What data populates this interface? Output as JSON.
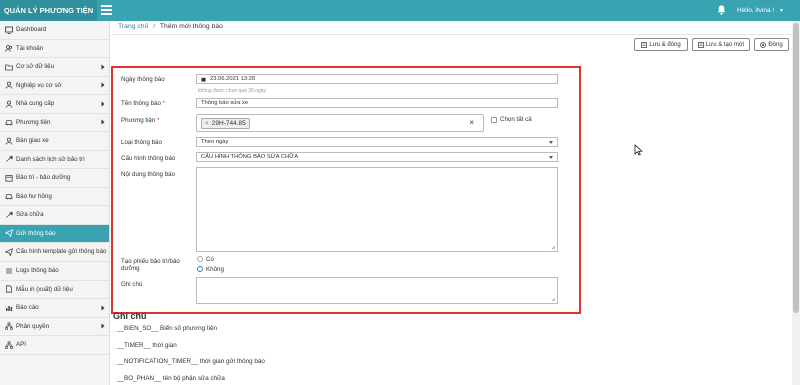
{
  "app": {
    "title": "QUẢN LÝ PHƯƠNG TIỆN",
    "user_greeting": "Hello, itvina !"
  },
  "sidebar": {
    "items": [
      {
        "label": "Dashboard",
        "icon": "monitor-icon",
        "has_arrow": false
      },
      {
        "label": "Tài khoản",
        "icon": "users-icon",
        "has_arrow": false
      },
      {
        "label": "Cơ sở dữ liệu",
        "icon": "folder-icon",
        "has_arrow": true
      },
      {
        "label": "Nghiệp vụ cơ sở",
        "icon": "user-icon",
        "has_arrow": true
      },
      {
        "label": "Nhà cung cấp",
        "icon": "user-icon",
        "has_arrow": true
      },
      {
        "label": "Phương tiện",
        "icon": "car-icon",
        "has_arrow": true
      },
      {
        "label": "Bàn giao xe",
        "icon": "user-icon",
        "has_arrow": false
      },
      {
        "label": "Danh sách lịch sử bảo trì",
        "icon": "wrench-icon",
        "has_arrow": false
      },
      {
        "label": "Bảo trì - bảo dưỡng",
        "icon": "calendar-icon",
        "has_arrow": false
      },
      {
        "label": "Báo hư hỏng",
        "icon": "car-icon",
        "has_arrow": false
      },
      {
        "label": "Sửa chữa",
        "icon": "wrench-icon",
        "has_arrow": false
      },
      {
        "label": "Gửi thông báo",
        "icon": "send-icon",
        "has_arrow": false,
        "active": true
      },
      {
        "label": "Cấu hình template gửi thông báo",
        "icon": "send-icon",
        "has_arrow": false
      },
      {
        "label": "Logs thông báo",
        "icon": "list-icon",
        "has_arrow": false
      },
      {
        "label": "Mẫu in (xuất) dữ liệu",
        "icon": "document-icon",
        "has_arrow": false
      },
      {
        "label": "Báo cáo",
        "icon": "chart-icon",
        "has_arrow": true
      },
      {
        "label": "Phân quyền",
        "icon": "sitemap-icon",
        "has_arrow": true
      },
      {
        "label": "API",
        "icon": "sitemap-icon",
        "has_arrow": false
      }
    ]
  },
  "breadcrumb": {
    "home": "Trang chủ",
    "separator": "/",
    "current": "Thêm mới thông báo"
  },
  "toolbar": {
    "save_close": "Lưu & đóng",
    "save_new": "Lưu & tạo mới",
    "close": "Đóng"
  },
  "form": {
    "date_label": "Ngày thông báo",
    "date_value": "23.06.2021 13:28",
    "date_hint": "không được chọn quá 30 ngày",
    "name_label": "Tên thông báo",
    "name_value": "Thông báo sửa xe",
    "vehicle_label": "Phương tiện",
    "vehicle_tag": "29H-744.85",
    "select_all_label": "Chọn tất cả",
    "type_label": "Loại thông báo",
    "type_value": "Theo ngày",
    "config_label": "Cấu hình thông báo",
    "config_value": "CẤU HÌNH THÔNG BÁO SỬA CHỮA",
    "content_label": "Nội dung thông báo",
    "ticket_label": "Tạo phiếu bảo trì/bảo dưỡng",
    "ticket_yes": "Có",
    "ticket_no": "Không",
    "note_label": "Ghi chú"
  },
  "notes": {
    "title": "Ghi chú",
    "lines": [
      "__BIEN_SO__ Biển số phương tiện",
      "__TIMER__ thời gian",
      "__NOTIFICATION_TIMER__ thời gian gửi thông báo",
      "__BO_PHAN__ tên bộ phận sửa chữa"
    ]
  },
  "colors": {
    "accent": "#3aa3b1",
    "highlight_border": "#e0322e",
    "link": "#2a7fb8"
  }
}
